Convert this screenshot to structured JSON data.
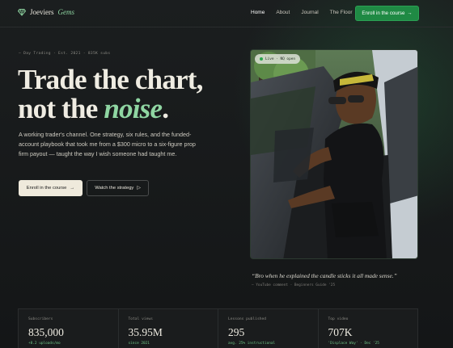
{
  "brand": {
    "name": "Joeviers",
    "accent": "Gems"
  },
  "nav": {
    "links": [
      {
        "label": "Home",
        "active": true
      },
      {
        "label": "About",
        "active": false
      },
      {
        "label": "Journal",
        "active": false
      },
      {
        "label": "The Floor",
        "active": false
      }
    ],
    "cta_label": "Enroll in the course",
    "cta_arrow": "→"
  },
  "hero": {
    "eyebrow": "— Day Trading · Est. 2021 · 835K subs",
    "title_line1": "Trade the chart,",
    "title_line2_prefix": "not the ",
    "title_line2_accent": "noise",
    "title_line2_suffix": ".",
    "lede": "A working trader's channel. One strategy, six rules, and the funded-account playbook that took me from a $300 micro to a six-figure prop firm payout — taught the way I wish someone had taught me.",
    "primary_label": "Enroll in the course",
    "primary_arrow": "→",
    "secondary_label": "Watch the strategy",
    "secondary_icon": "▷"
  },
  "photo": {
    "badge": "Live · NQ open",
    "quote": "“Bro when he explained the candle sticks it all made sense.”",
    "quote_source": "— YouTube comment · Beginners Guide '25"
  },
  "stats": [
    {
      "label": "Subscribers",
      "value": "835,000",
      "sub": "+8.2 uploads/mo"
    },
    {
      "label": "Total views",
      "value": "35.95M",
      "sub": "since 2021"
    },
    {
      "label": "Lessons published",
      "value": "295",
      "sub": "avg. 25% instructional"
    },
    {
      "label": "Top video",
      "value": "707K",
      "sub": "'Displace Way' · Dec '25"
    }
  ],
  "colors": {
    "accent_green": "#8fd6a2",
    "cta_green": "#1f8a44",
    "background": "#161819",
    "cream": "#efeadc"
  }
}
